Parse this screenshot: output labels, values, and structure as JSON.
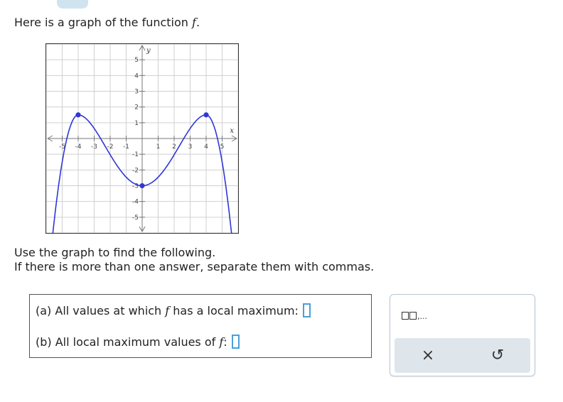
{
  "intro": {
    "text": "Here is a graph of the function ",
    "fn": "f",
    "period": "."
  },
  "graph": {
    "x_axis_label": "x",
    "y_axis_label": "y",
    "x_tick_labels": [
      "-5",
      "-4",
      "-3",
      "-2",
      "-1",
      "1",
      "2",
      "3",
      "4",
      "5"
    ],
    "y_tick_labels": [
      "5",
      "4",
      "3",
      "2",
      "1",
      "-1",
      "-2",
      "-3",
      "-4",
      "-5"
    ],
    "curve_color": "#2f37d6",
    "grid_color": "#d0d0d0"
  },
  "chart_data": {
    "type": "line",
    "x_range": [
      -6,
      6
    ],
    "y_range": [
      -6,
      6
    ],
    "grid": true,
    "key_points": [
      {
        "x": -4,
        "y": 1.5,
        "marked": true
      },
      {
        "x": 0,
        "y": -3,
        "marked": true
      },
      {
        "x": 4,
        "y": 1.5,
        "marked": true
      }
    ],
    "ends": "both arrows pointing down"
  },
  "instructions": {
    "line1": "Use the graph to find the following.",
    "line2": "If there is more than one answer, separate them with commas."
  },
  "questions": {
    "a": {
      "prefix": "(a) All values at which ",
      "fn": "f",
      "suffix": " has a local maximum:"
    },
    "b": {
      "prefix": "(b) All local maximum values of ",
      "fn": "f",
      "suffix": ":"
    }
  },
  "toolbox": {
    "list_icon_text": ",...",
    "clear_symbol": "×",
    "reset_symbol": "↺"
  }
}
